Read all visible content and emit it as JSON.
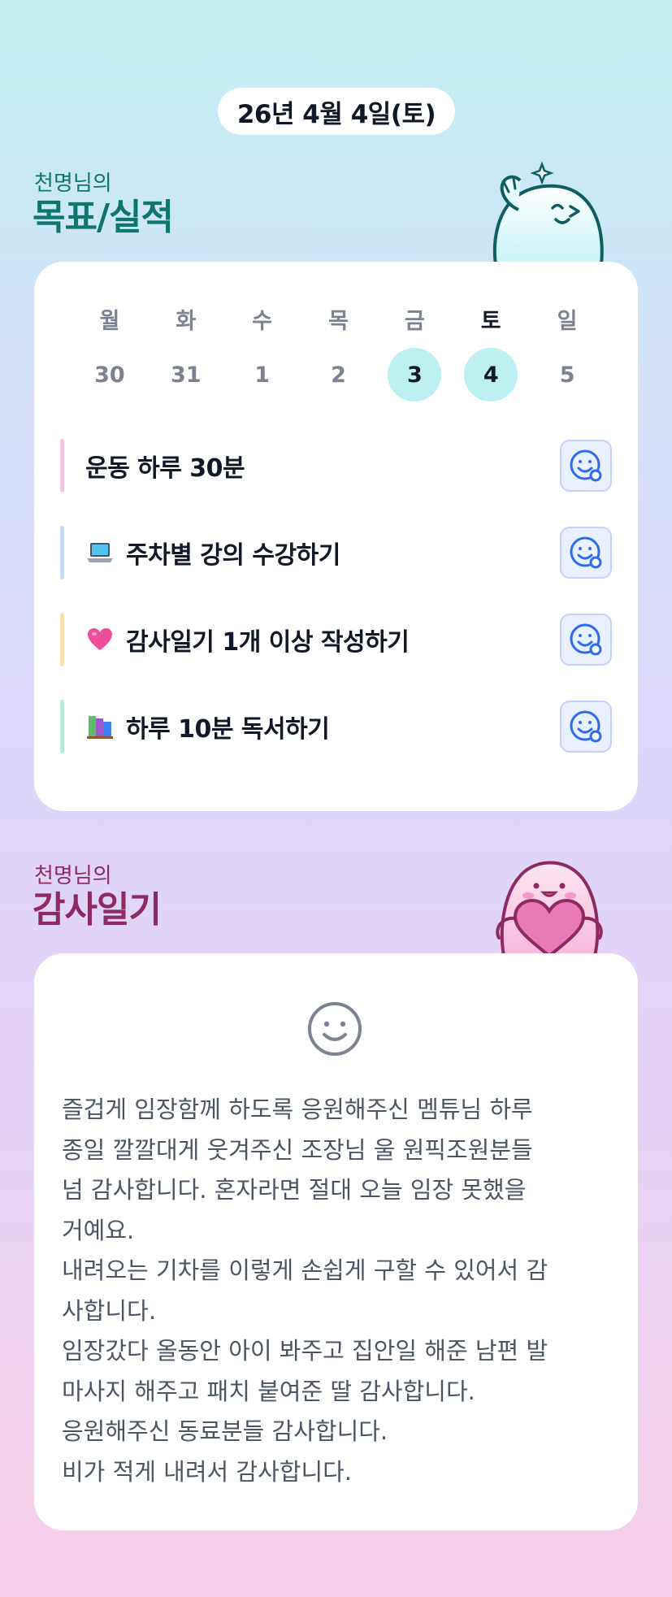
{
  "header": {
    "date": "26년 4월 4일(토)"
  },
  "goals_section": {
    "subtitle": "천명님의",
    "title": "목표/실적"
  },
  "week": {
    "days": [
      "월",
      "화",
      "수",
      "목",
      "금",
      "토",
      "일"
    ],
    "dates": [
      "30",
      "31",
      "1",
      "2",
      "3",
      "4",
      "5"
    ],
    "highlighted_dates": [
      "3",
      "4"
    ],
    "active_day": "토"
  },
  "goals": [
    {
      "label": "운동 하루 30분",
      "icon": "none",
      "bar_color": "#f7c4e4"
    },
    {
      "label": "주차별 강의 수강하기",
      "icon": "laptop-icon",
      "bar_color": "#c9d7f3"
    },
    {
      "label": "감사일기 1개 이상 작성하기",
      "icon": "heart-icon",
      "bar_color": "#fde1b0"
    },
    {
      "label": "하루 10분 독서하기",
      "icon": "books-icon",
      "bar_color": "#b8ecd9"
    }
  ],
  "gratitude_section": {
    "subtitle": "천명님의",
    "title": "감사일기"
  },
  "gratitude": {
    "mood_icon": "smile-icon",
    "text": "즐겁게 임장함께 하도록 응원해주신 멤튜님 하루\n종일 깔깔대게 웃겨주신 조장님 울 원픽조원분들\n넘 감사합니다. 혼자라면 절대 오늘 임장 못했을\n거예요.\n내려오는 기차를 이렇게 손쉽게 구할 수 있어서 감\n사합니다.\n임장갔다 올동안 아이 봐주고 집안일 해준 남편 발\n마사지 해주고 패치 붙여준 딸 감사합니다.\n응원해주신 동료분들 감사합니다.\n비가 적게 내려서 감사합니다."
  },
  "colors": {
    "accent_teal": "#0f766e",
    "accent_plum": "#8e2a62",
    "highlight_circle": "#bdf0f3"
  }
}
